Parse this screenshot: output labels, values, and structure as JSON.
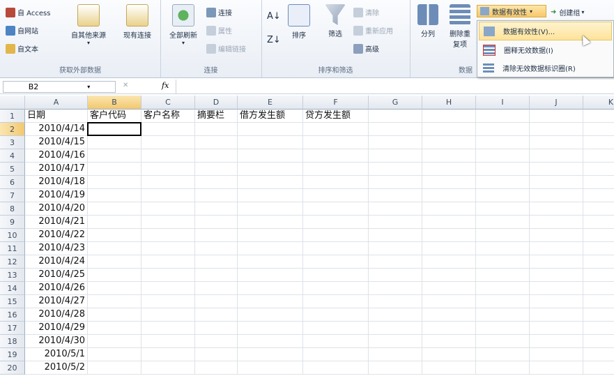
{
  "ribbon": {
    "external_data": {
      "label": "获取外部数据",
      "access": "自 Access",
      "web": "自网站",
      "text": "自文本",
      "other": "自其他来源",
      "existing": "现有连接"
    },
    "connections": {
      "label": "连接",
      "refresh_all": "全部刷新",
      "connections": "连接",
      "properties": "属性",
      "edit_links": "编辑链接"
    },
    "sort_filter": {
      "label": "排序和筛选",
      "sort": "排序",
      "filter": "筛选",
      "clear": "清除",
      "reapply": "重新应用",
      "advanced": "高级"
    },
    "data_tools": {
      "label": "数据",
      "text_to_columns": "分列",
      "remove_duplicates": "删除重复项",
      "data_validation": "数据有效性",
      "group": "创建组"
    }
  },
  "menu": {
    "items": [
      "数据有效性(V)...",
      "圈释无效数据(I)",
      "清除无效数据标识圈(R)"
    ]
  },
  "formula_bar": {
    "name_box": "B2",
    "fx": "fx",
    "cancel": "✕"
  },
  "sheet": {
    "columns": [
      "A",
      "B",
      "C",
      "D",
      "E",
      "F",
      "G",
      "H",
      "I",
      "J",
      "K"
    ],
    "rows": [
      "1",
      "2",
      "3",
      "4",
      "5",
      "6",
      "7",
      "8",
      "9",
      "10",
      "11",
      "12",
      "13",
      "14",
      "15",
      "16",
      "17",
      "18",
      "19",
      "20"
    ],
    "headers": [
      "日期",
      "客户代码",
      "客户名称",
      "摘要栏",
      "借方发生额",
      "贷方发生额"
    ],
    "dates": [
      "2010/4/14",
      "2010/4/15",
      "2010/4/16",
      "2010/4/17",
      "2010/4/18",
      "2010/4/19",
      "2010/4/20",
      "2010/4/21",
      "2010/4/22",
      "2010/4/23",
      "2010/4/24",
      "2010/4/25",
      "2010/4/26",
      "2010/4/27",
      "2010/4/28",
      "2010/4/29",
      "2010/4/30",
      "2010/5/1",
      "2010/5/2"
    ],
    "active_cell": "B2"
  },
  "colors": {
    "accent": "#f2c870",
    "grid": "#dde2e8",
    "ribbon_bg": "#e9eef5"
  }
}
